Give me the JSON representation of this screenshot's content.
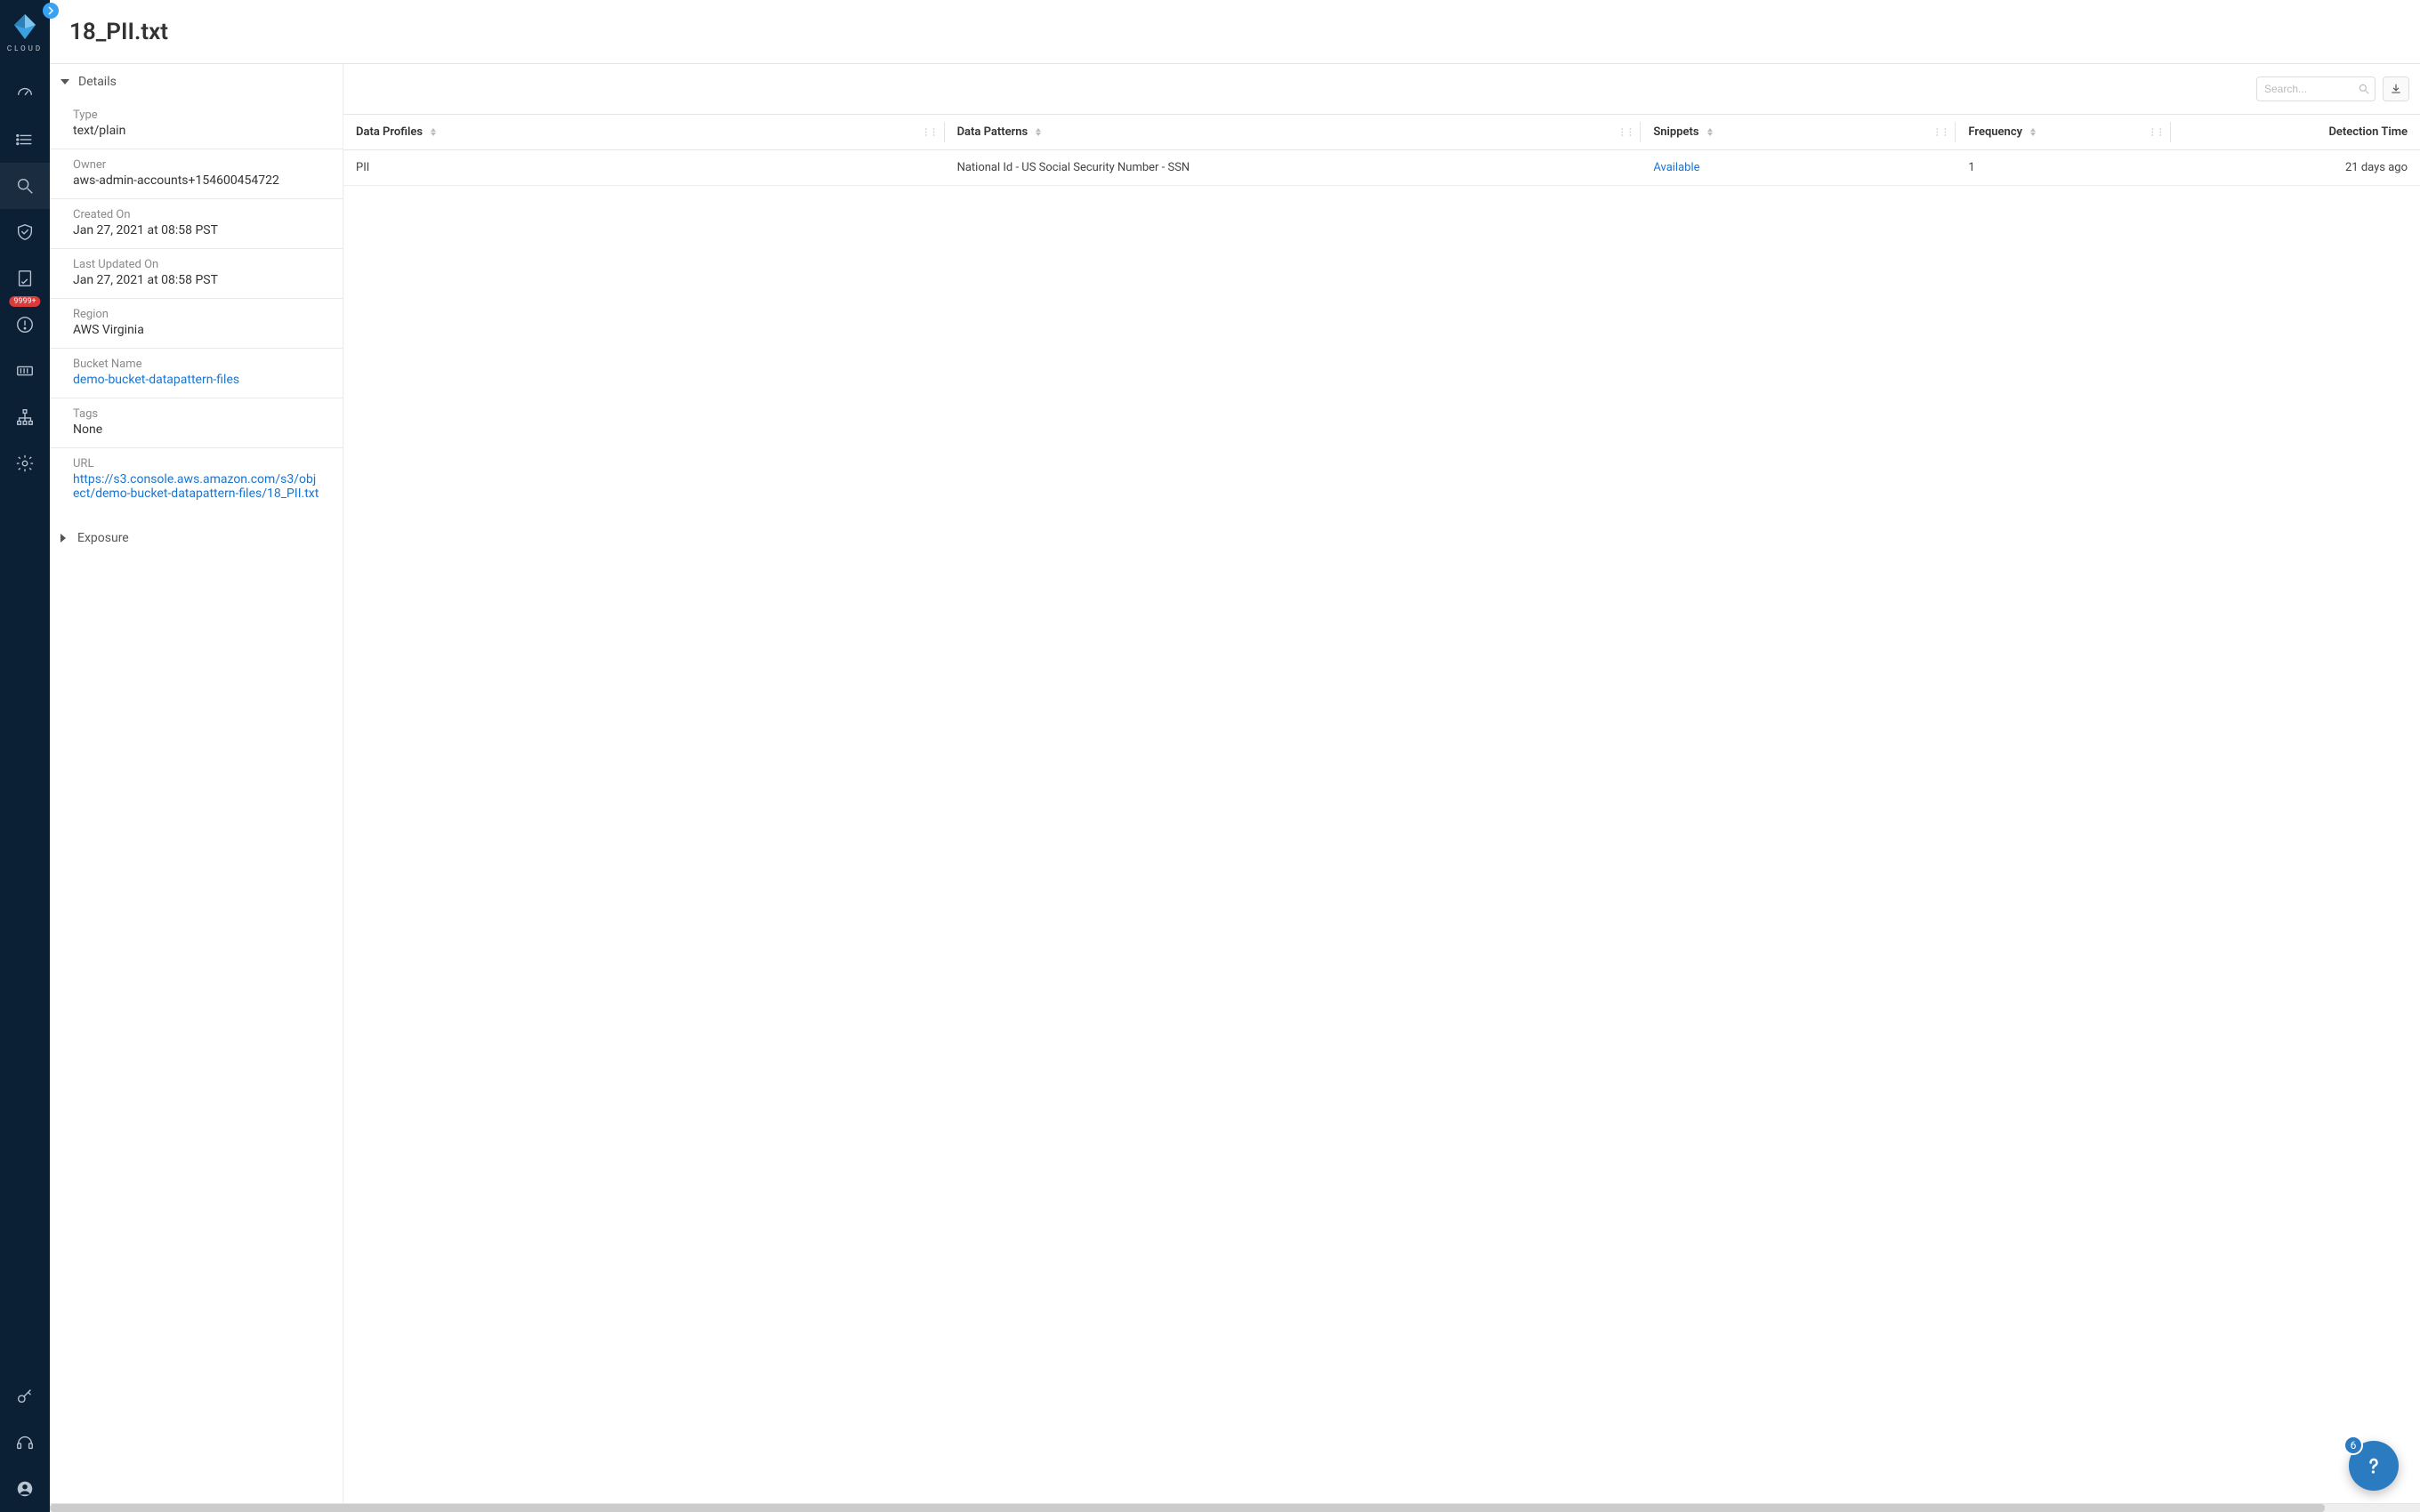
{
  "brand": {
    "label": "CLOUD"
  },
  "sidebar": {
    "collapse_tooltip": "Expand",
    "alertBadge": "9999+",
    "items": [
      {
        "name": "dashboard"
      },
      {
        "name": "list"
      },
      {
        "name": "investigate",
        "active": true
      },
      {
        "name": "compliance"
      },
      {
        "name": "policy"
      },
      {
        "name": "alerts",
        "badge": "9999+"
      },
      {
        "name": "inventory"
      },
      {
        "name": "network"
      },
      {
        "name": "settings"
      }
    ],
    "footerItems": [
      {
        "name": "keys"
      },
      {
        "name": "support"
      },
      {
        "name": "account"
      }
    ]
  },
  "header": {
    "title": "18_PII.txt"
  },
  "details": {
    "sectionTitle": "Details",
    "fields": {
      "type": {
        "label": "Type",
        "value": "text/plain"
      },
      "owner": {
        "label": "Owner",
        "value": "aws-admin-accounts+154600454722"
      },
      "created": {
        "label": "Created On",
        "value": "Jan 27, 2021 at 08:58 PST"
      },
      "updated": {
        "label": "Last Updated On",
        "value": "Jan 27, 2021 at 08:58 PST"
      },
      "region": {
        "label": "Region",
        "value": "AWS Virginia"
      },
      "bucket": {
        "label": "Bucket Name",
        "value": "demo-bucket-datapattern-files",
        "link": true
      },
      "tags": {
        "label": "Tags",
        "value": "None"
      },
      "url": {
        "label": "URL",
        "value": "https://s3.console.aws.amazon.com/s3/object/demo-bucket-datapattern-files/18_PII.txt",
        "link": true
      }
    }
  },
  "exposure": {
    "sectionTitle": "Exposure"
  },
  "toolbar": {
    "searchPlaceholder": "Search..."
  },
  "table": {
    "columns": {
      "profiles": "Data Profiles",
      "patterns": "Data Patterns",
      "snippets": "Snippets",
      "frequency": "Frequency",
      "dtime": "Detection Time"
    },
    "rows": [
      {
        "profile": "PII",
        "pattern": "National Id - US Social Security Number - SSN",
        "snippet": "Available",
        "frequency": "1",
        "dtime": "21 days ago"
      }
    ]
  },
  "help": {
    "count": "6"
  }
}
